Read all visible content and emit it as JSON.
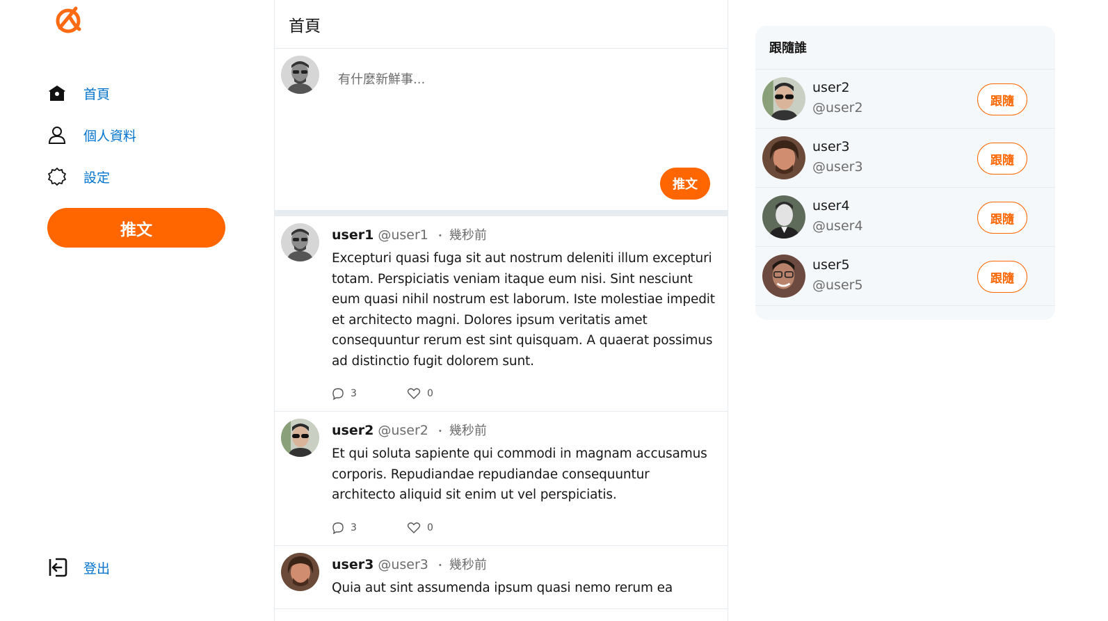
{
  "colors": {
    "accent": "#ff6600",
    "link": "#0073cf",
    "border": "#e6ecf0",
    "panel": "#f5f8fa"
  },
  "sidebar": {
    "logo": "alpha-logo",
    "items": [
      {
        "label": "首頁",
        "icon": "home-icon"
      },
      {
        "label": "個人資料",
        "icon": "user-icon"
      },
      {
        "label": "設定",
        "icon": "gear-icon"
      }
    ],
    "tweet_button": "推文",
    "logout": {
      "label": "登出",
      "icon": "logout-icon"
    }
  },
  "main": {
    "title": "首頁",
    "composer": {
      "placeholder": "有什麼新鮮事...",
      "submit": "推文"
    },
    "tweets": [
      {
        "name": "user1",
        "handle": "@user1",
        "dot": "・",
        "time": "幾秒前",
        "text": "Excepturi quasi fuga sit aut nostrum deleniti illum excepturi totam. Perspiciatis veniam itaque eum nisi. Sint nesciunt eum quasi nihil nostrum est laborum. Iste molestiae impedit et architecto magni. Dolores ipsum veritatis amet consequuntur rerum est sint quisquam. A quaerat possimus ad distinctio fugit dolorem sunt.",
        "replies": "3",
        "likes": "0"
      },
      {
        "name": "user2",
        "handle": "@user2",
        "dot": "・",
        "time": "幾秒前",
        "text": "Et qui soluta sapiente qui commodi in magnam accusamus corporis. Repudiandae repudiandae consequuntur architecto aliquid sit enim ut vel perspiciatis.",
        "replies": "3",
        "likes": "0"
      },
      {
        "name": "user3",
        "handle": "@user3",
        "dot": "・",
        "time": "幾秒前",
        "text": "Quia aut sint assumenda ipsum quasi nemo rerum ea",
        "replies": "",
        "likes": ""
      }
    ]
  },
  "follow": {
    "title": "跟隨誰",
    "users": [
      {
        "name": "user2",
        "handle": "@user2",
        "button": "跟隨"
      },
      {
        "name": "user3",
        "handle": "@user3",
        "button": "跟隨"
      },
      {
        "name": "user4",
        "handle": "@user4",
        "button": "跟隨"
      },
      {
        "name": "user5",
        "handle": "@user5",
        "button": "跟隨"
      }
    ]
  }
}
